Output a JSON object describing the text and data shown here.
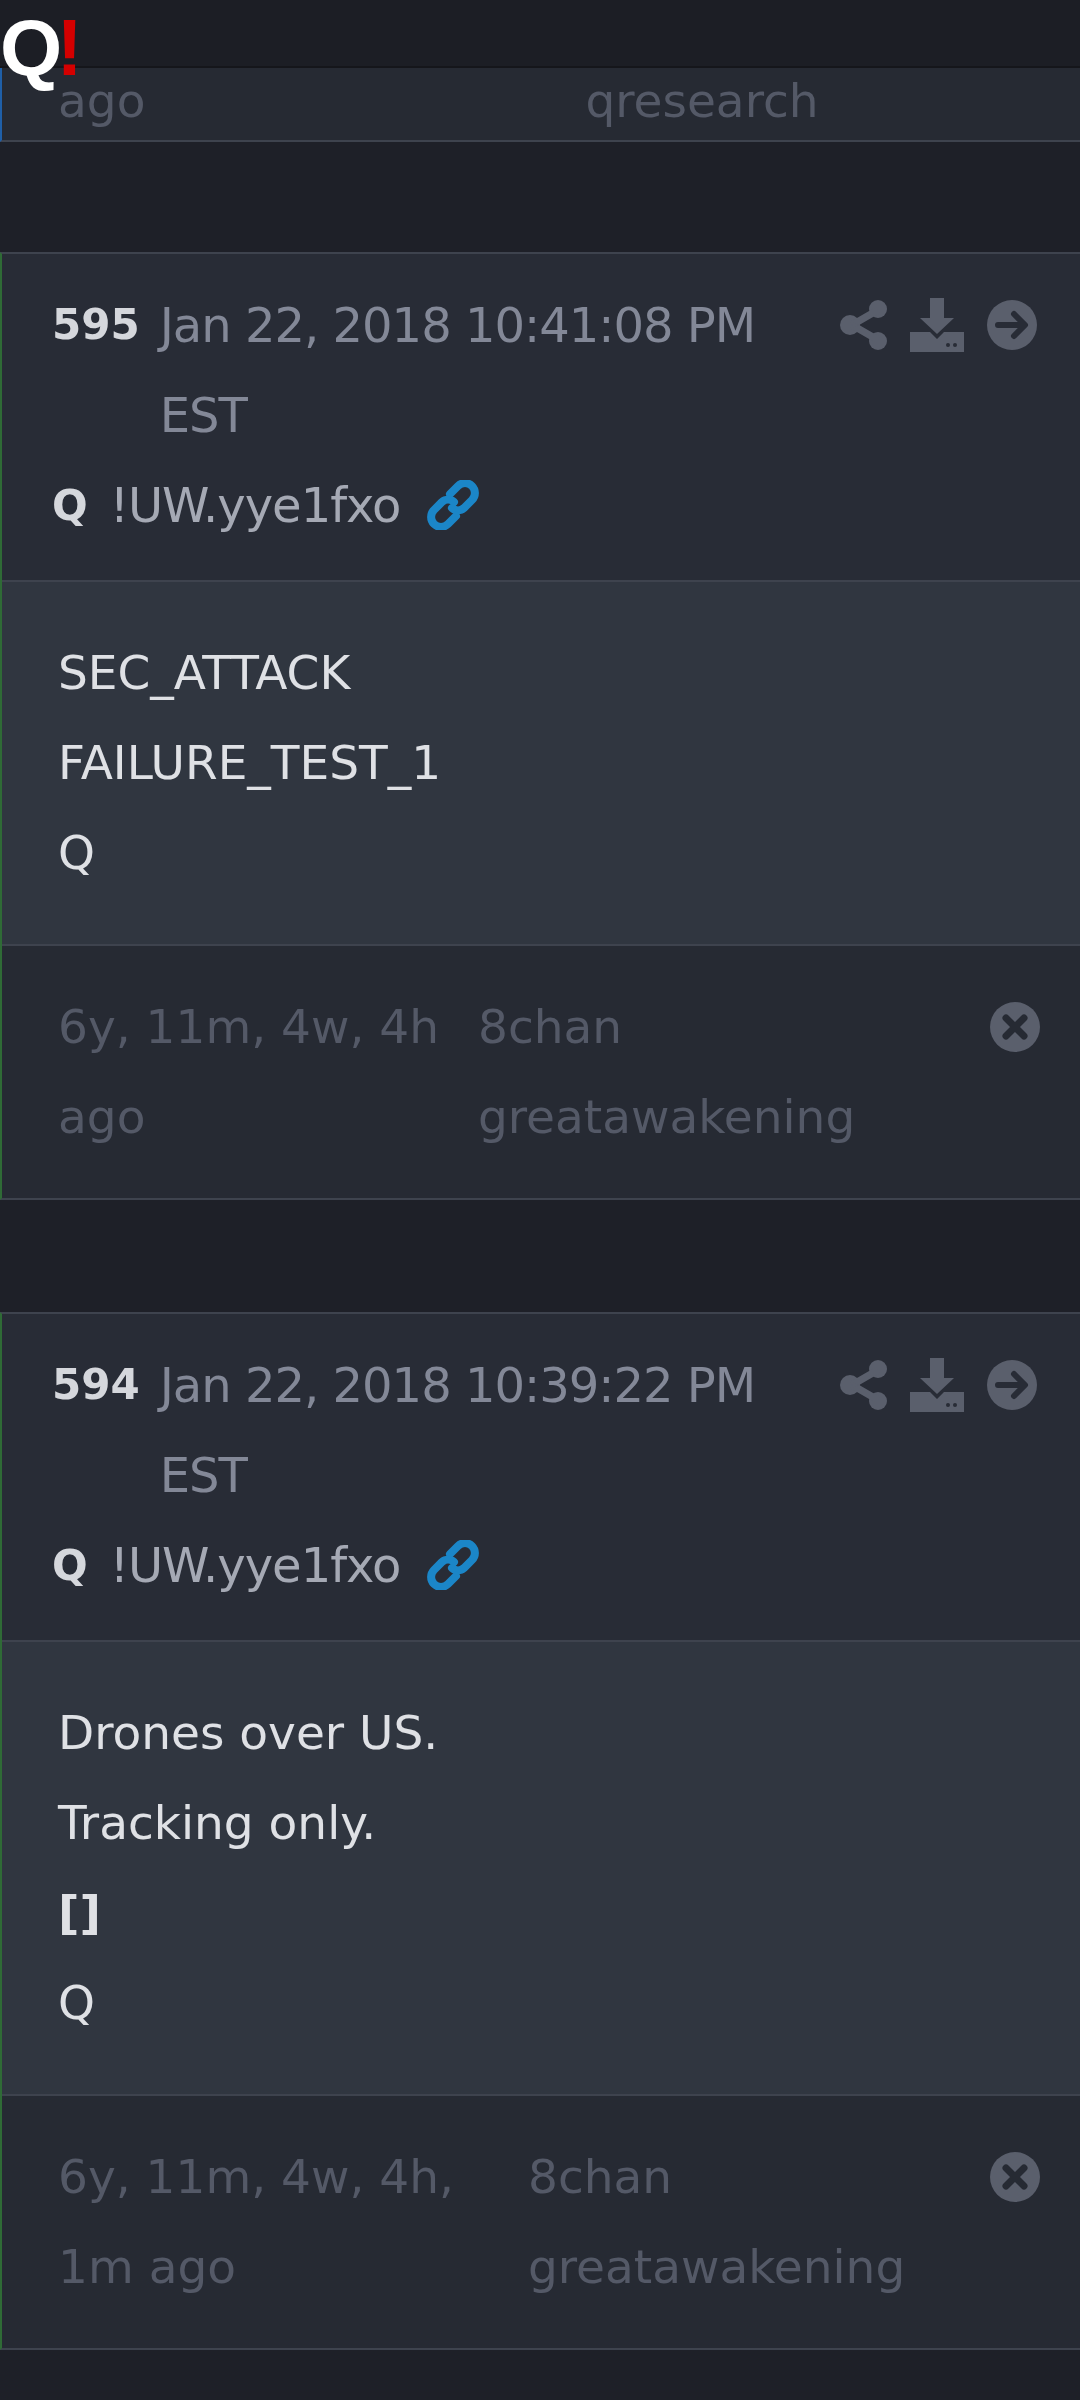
{
  "logo": {
    "letter": "Q",
    "mark": "!"
  },
  "partial_card": {
    "time": "ago",
    "source": "qresearch"
  },
  "posts": [
    {
      "number": "595",
      "date": "Jan 22, 2018 10:41:08 PM",
      "timezone": "EST",
      "author": "Q",
      "tripcode": "!UW.yye1fxo",
      "lines": [
        {
          "text": "SEC_ATTACK",
          "bold": false
        },
        {
          "text": "FAILURE_TEST_1",
          "bold": false
        },
        {
          "text": "Q",
          "bold": false
        }
      ],
      "age": "6y, 11m, 4w, 4h ago",
      "board_site": "8chan",
      "board": "greatawakening"
    },
    {
      "number": "594",
      "date": "Jan 22, 2018 10:39:22 PM",
      "timezone": "EST",
      "author": "Q",
      "tripcode": "!UW.yye1fxo",
      "lines": [
        {
          "text": "Drones over US.",
          "bold": false
        },
        {
          "text": "Tracking only.",
          "bold": false
        },
        {
          "text": "[]",
          "bold": true
        },
        {
          "text": "Q",
          "bold": false
        }
      ],
      "age": "6y, 11m, 4w, 4h, 1m ago",
      "board_site": "8chan",
      "board": "greatawakening"
    }
  ]
}
